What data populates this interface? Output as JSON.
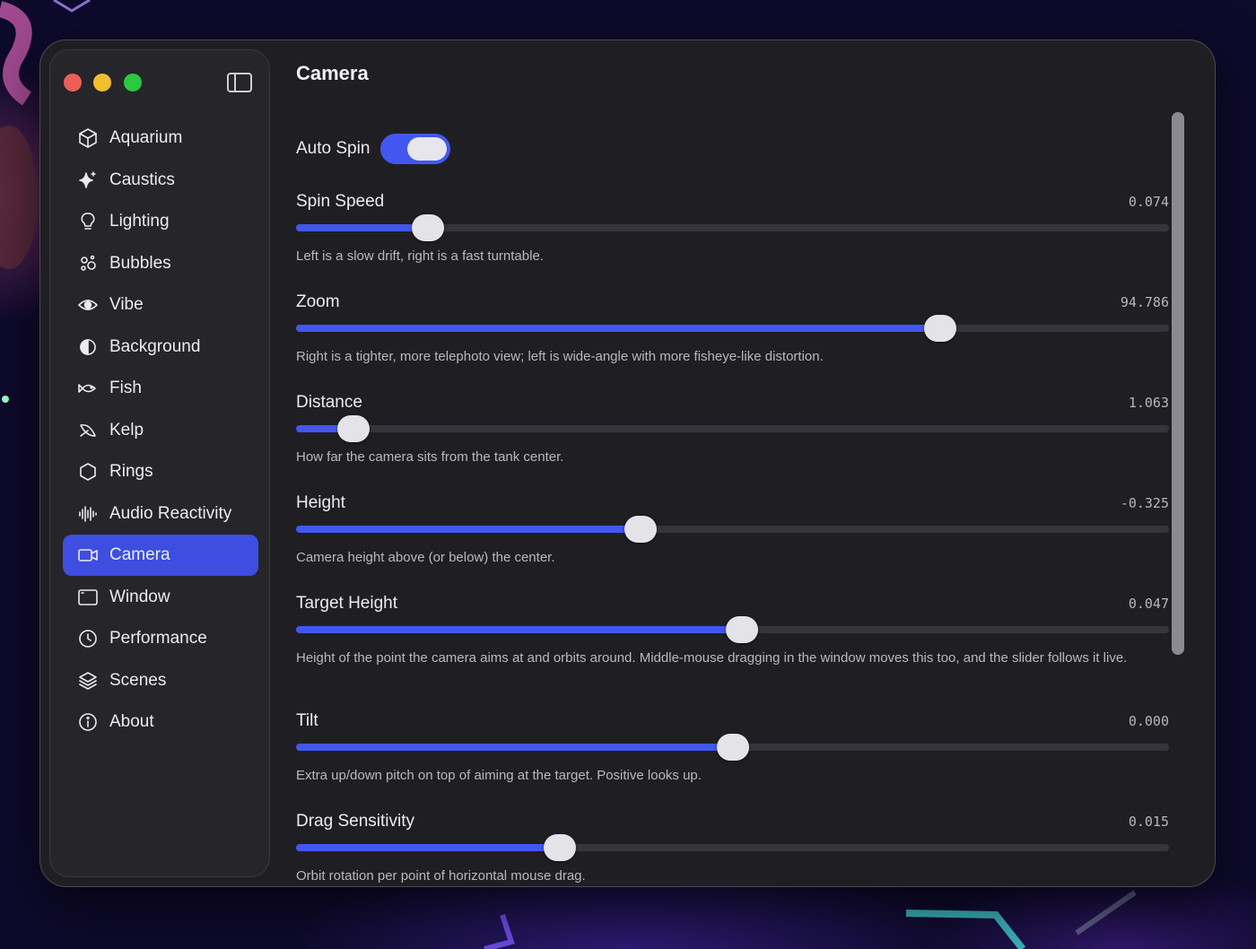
{
  "window": {
    "title": "Camera"
  },
  "sidebar": {
    "items": [
      {
        "label": "Aquarium",
        "icon": "cube-icon",
        "active": false
      },
      {
        "label": "Caustics",
        "icon": "sparkle-icon",
        "active": false
      },
      {
        "label": "Lighting",
        "icon": "lightbulb-icon",
        "active": false
      },
      {
        "label": "Bubbles",
        "icon": "bubbles-icon",
        "active": false
      },
      {
        "label": "Vibe",
        "icon": "eye-icon",
        "active": false
      },
      {
        "label": "Background",
        "icon": "half-circle-icon",
        "active": false
      },
      {
        "label": "Fish",
        "icon": "fish-icon",
        "active": false
      },
      {
        "label": "Kelp",
        "icon": "leaf-icon",
        "active": false
      },
      {
        "label": "Rings",
        "icon": "hexagon-icon",
        "active": false
      },
      {
        "label": "Audio Reactivity",
        "icon": "waveform-icon",
        "active": false
      },
      {
        "label": "Camera",
        "icon": "video-camera-icon",
        "active": true
      },
      {
        "label": "Window",
        "icon": "window-icon",
        "active": false
      },
      {
        "label": "Performance",
        "icon": "gauge-icon",
        "active": false
      },
      {
        "label": "Scenes",
        "icon": "layers-icon",
        "active": false
      },
      {
        "label": "About",
        "icon": "info-icon",
        "active": false
      }
    ]
  },
  "main": {
    "title": "Camera",
    "auto_spin": {
      "label": "Auto Spin",
      "on": true
    },
    "sliders": [
      {
        "label": "Spin Speed",
        "value": "0.074",
        "fraction": 0.151,
        "description": "Left is a slow drift, right is a fast turntable."
      },
      {
        "label": "Zoom",
        "value": "94.786",
        "fraction": 0.738,
        "description": "Right is a tighter, more telephoto view; left is wide-angle with more fisheye-like distortion."
      },
      {
        "label": "Distance",
        "value": "1.063",
        "fraction": 0.066,
        "description": "How far the camera sits from the tank center."
      },
      {
        "label": "Height",
        "value": "-0.325",
        "fraction": 0.395,
        "description": "Camera height above (or below) the center."
      },
      {
        "label": "Target Height",
        "value": "0.047",
        "fraction": 0.511,
        "description": "Height of the point the camera aims at and orbits around. Middle-mouse dragging in the window moves this too, and the slider follows it live."
      },
      {
        "label": "Tilt",
        "value": "0.000",
        "fraction": 0.5,
        "description": "Extra up/down pitch on top of aiming at the target. Positive looks up."
      },
      {
        "label": "Drag Sensitivity",
        "value": "0.015",
        "fraction": 0.302,
        "description": "Orbit rotation per point of horizontal mouse drag."
      }
    ]
  },
  "colors": {
    "accent": "#4257f0",
    "window_bg": "#1f1f23",
    "sidebar_bg": "#25252a"
  }
}
